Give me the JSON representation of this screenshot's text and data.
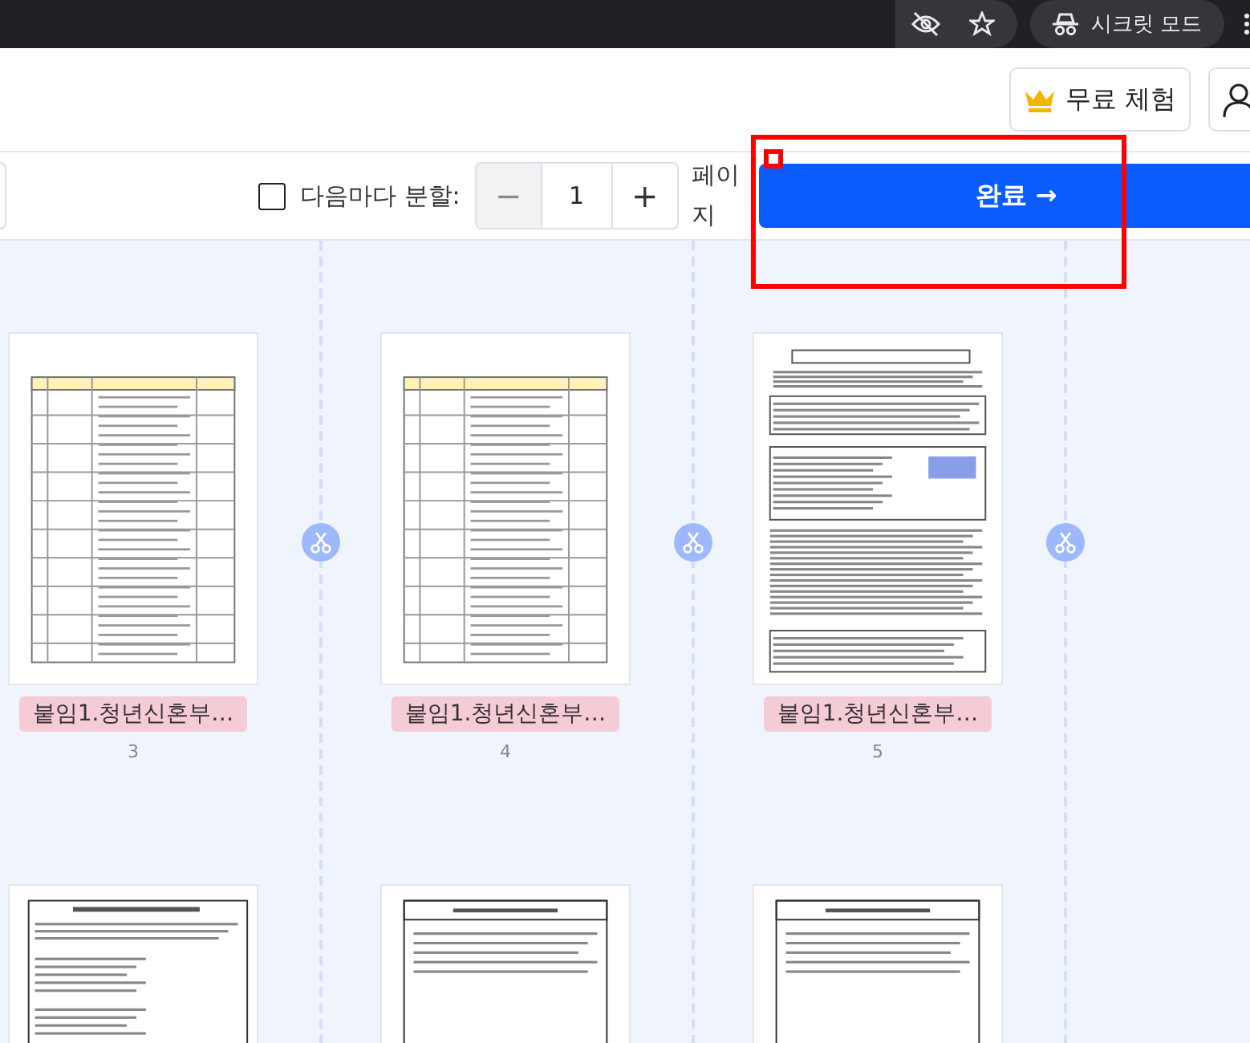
{
  "browser_bar": {
    "incognito_label": "시크릿 모드"
  },
  "header": {
    "trial_button": "무료 체험"
  },
  "toolbar": {
    "split": {
      "label": "다음마다 분할:",
      "checked": false
    },
    "stepper": {
      "minus": "−",
      "value": "1",
      "plus": "+",
      "minus_disabled": true
    },
    "unit": "페이지",
    "done_button": "완료 →"
  },
  "pages": [
    {
      "kind": "table",
      "label": "붙임1.청년신혼부…",
      "number": "3"
    },
    {
      "kind": "table",
      "label": "붙임1.청년신혼부…",
      "number": "4"
    },
    {
      "kind": "consent",
      "label": "붙임1.청년신혼부…",
      "number": "5"
    },
    {
      "kind": "form"
    },
    {
      "kind": "letter"
    },
    {
      "kind": "letter"
    }
  ]
}
